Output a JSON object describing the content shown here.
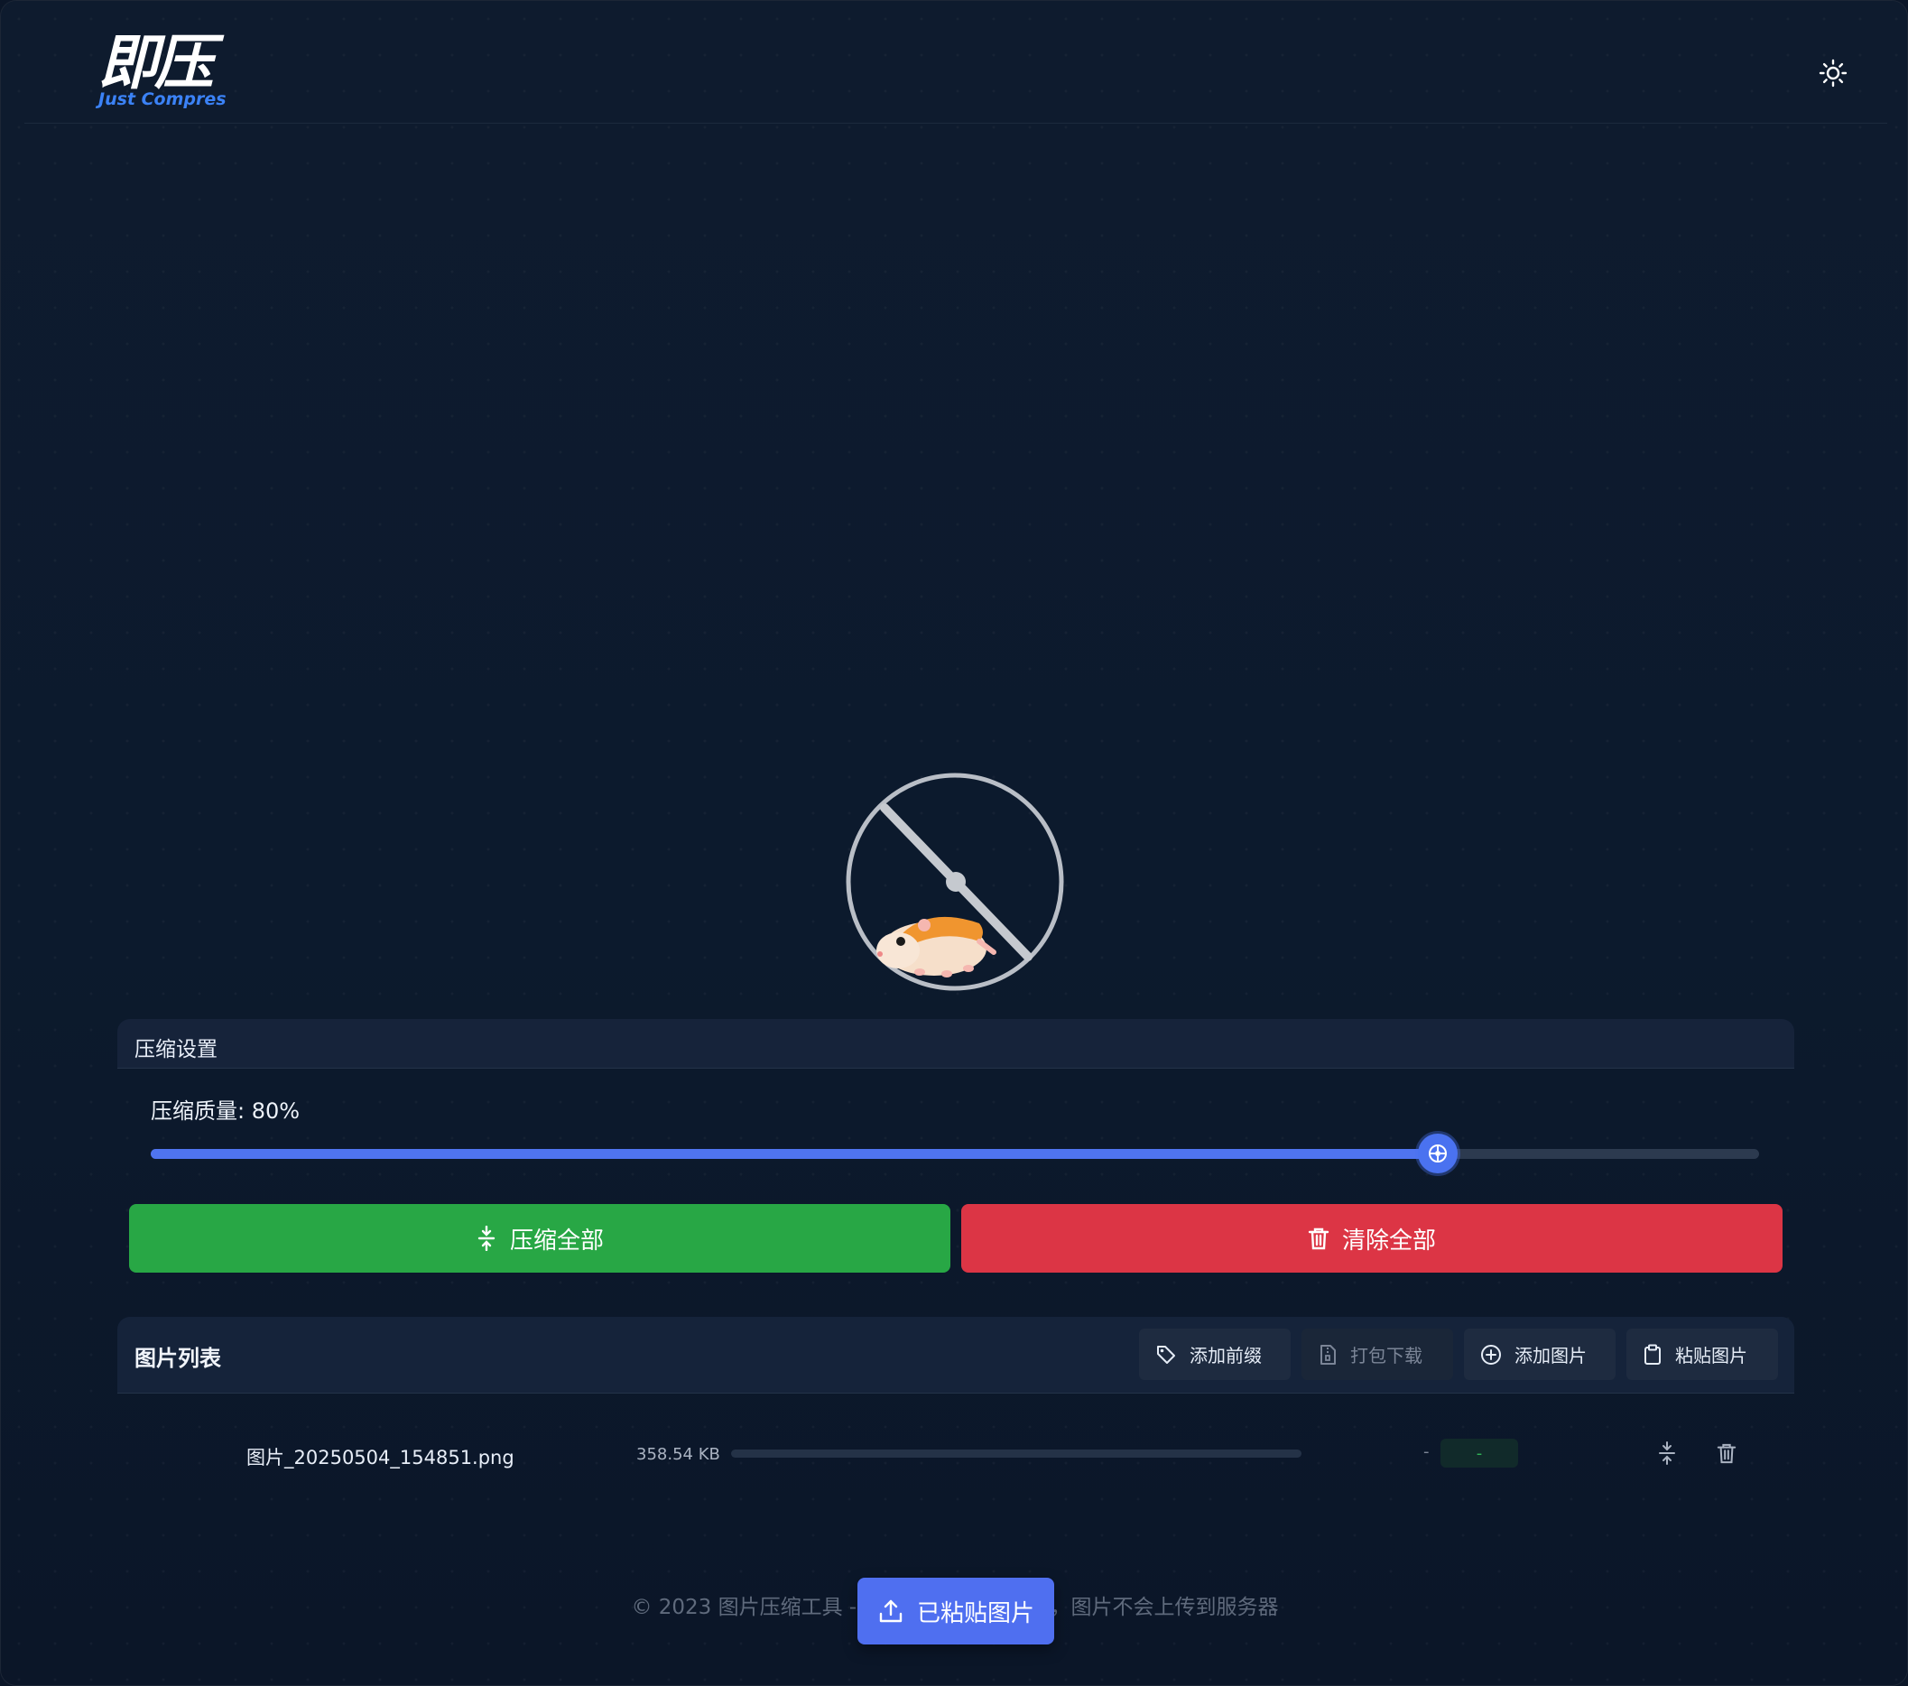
{
  "header": {
    "logo_text": "即压",
    "logo_subtitle": "Just Compres",
    "theme_toggle_icon": "sun-icon"
  },
  "illustration": {
    "icon": "hamster-wheel-illustration"
  },
  "settings": {
    "title": "压缩设置",
    "quality_label": "压缩质量: 80%",
    "quality_value": 80,
    "slider_min": 0,
    "slider_max": 100
  },
  "actions": {
    "compress_all": "压缩全部",
    "compress_icon": "compress-icon",
    "clear_all": "清除全部",
    "clear_icon": "trash-icon"
  },
  "image_list": {
    "title": "图片列表",
    "toolbar": [
      {
        "label": "添加前缀",
        "icon": "tag-icon",
        "enabled": true
      },
      {
        "label": "打包下载",
        "icon": "zip-file-icon",
        "enabled": false
      },
      {
        "label": "添加图片",
        "icon": "plus-circle-icon",
        "enabled": true
      },
      {
        "label": "粘贴图片",
        "icon": "clipboard-icon",
        "enabled": true
      }
    ],
    "files": [
      {
        "name": "图片_20250504_154851.png",
        "size": "358.54 KB",
        "progress": 0,
        "compressed_size": "-",
        "ratio": "-"
      }
    ]
  },
  "footer": {
    "text": "© 2023 图片压缩工具 - 所有处理在本地完成，图片不会上传到服务器"
  },
  "paste_button": {
    "label": "已粘贴图片",
    "icon": "upload-icon"
  },
  "colors": {
    "background": "#0b1628",
    "accent": "#4f74f0",
    "success": "#28a745",
    "danger": "#dc3545"
  }
}
